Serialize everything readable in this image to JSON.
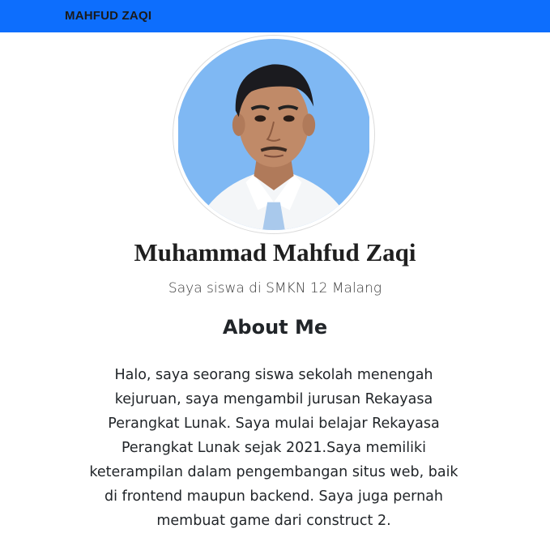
{
  "navbar": {
    "brand": "MAHFUD ZAQI",
    "background": "#0d6efd"
  },
  "profile": {
    "avatar_alt": "profile-photo",
    "name": "Muhammad Mahfud Zaqi",
    "tagline": "Saya siswa di SMKN 12 Malang"
  },
  "about": {
    "title": "About Me",
    "text": "Halo, saya seorang siswa sekolah menengah kejuruan, saya mengambil jurusan Rekayasa Perangkat Lunak. Saya mulai belajar Rekayasa Perangkat Lunak sejak 2021.Saya memiliki keterampilan dalam pengembangan situs web, baik di frontend maupun backend. Saya juga pernah membuat game dari construct 2."
  }
}
